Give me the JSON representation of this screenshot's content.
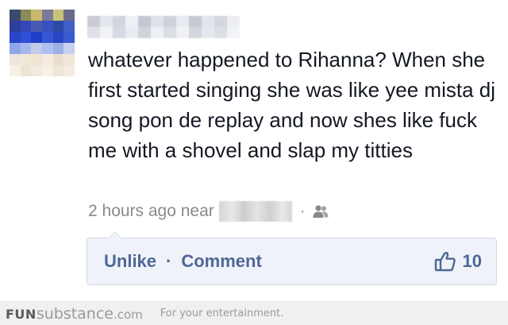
{
  "post": {
    "author_name": "",
    "text": "whatever happened to Rihanna? When she first started singing she was like yee mista dj song pon de replay and now shes like fuck me with a shovel and slap my titties",
    "timestamp": "2 hours ago near",
    "location": "",
    "audience_icon": "friends-icon"
  },
  "actions": {
    "unlike_label": "Unlike",
    "separator": "·",
    "comment_label": "Comment",
    "like_icon": "thumbs-up-icon",
    "like_count": "10"
  },
  "watermark": {
    "brand_bold": "FUN",
    "brand_light": "substance",
    "brand_domain": ".com",
    "tagline": "For your entertainment."
  },
  "colors": {
    "link": "#4e6797",
    "action_bg": "#eff2f8",
    "meta_text": "#8a8a8a"
  }
}
